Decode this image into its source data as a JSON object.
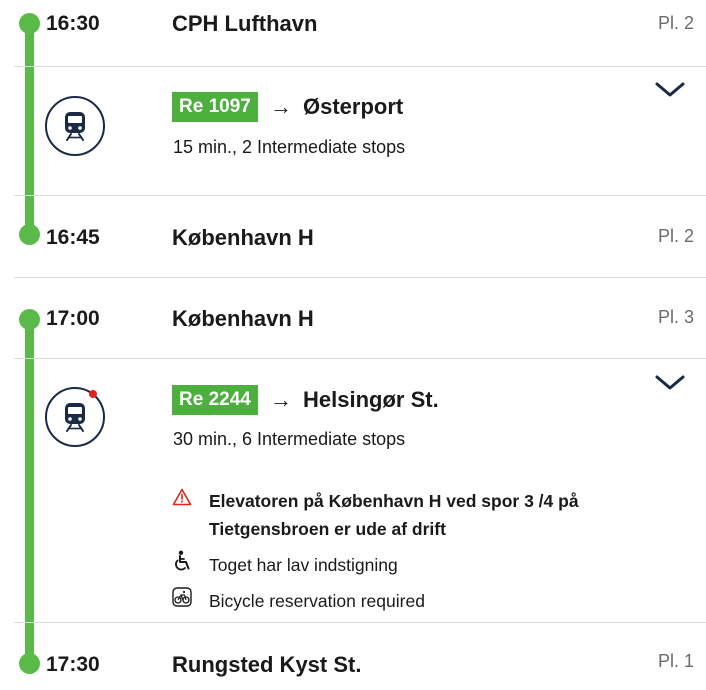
{
  "leg1": {
    "departure": {
      "time": "16:30",
      "station": "CPH Lufthavn",
      "platform": "Pl. 2"
    },
    "train": {
      "line": "Re 1097",
      "arrow": "→",
      "destination": "Østerport",
      "summary": "15 min., 2 Intermediate stops"
    },
    "arrival": {
      "time": "16:45",
      "station": "København H",
      "platform": "Pl. 2"
    }
  },
  "leg2": {
    "departure": {
      "time": "17:00",
      "station": "København H",
      "platform": "Pl. 3"
    },
    "train": {
      "line": "Re 2244",
      "arrow": "→",
      "destination": "Helsingør St.",
      "summary": "30 min., 6 Intermediate stops"
    },
    "notices": [
      {
        "icon": "warning-triangle-icon",
        "text": "Elevatoren på København H ved spor 3 /4 på Tietgensbroen er ude af drift"
      },
      {
        "icon": "wheelchair-icon",
        "text": "Toget har lav indstigning"
      },
      {
        "icon": "bicycle-icon",
        "text": "Bicycle reservation required"
      }
    ],
    "arrival": {
      "time": "17:30",
      "station": "Rungsted Kyst St.",
      "platform": "Pl. 1"
    }
  },
  "colors": {
    "route_line": "#5bb949",
    "badge": "#4caf3e",
    "icon_navy": "#1b2a47",
    "alert": "#e2231a"
  }
}
